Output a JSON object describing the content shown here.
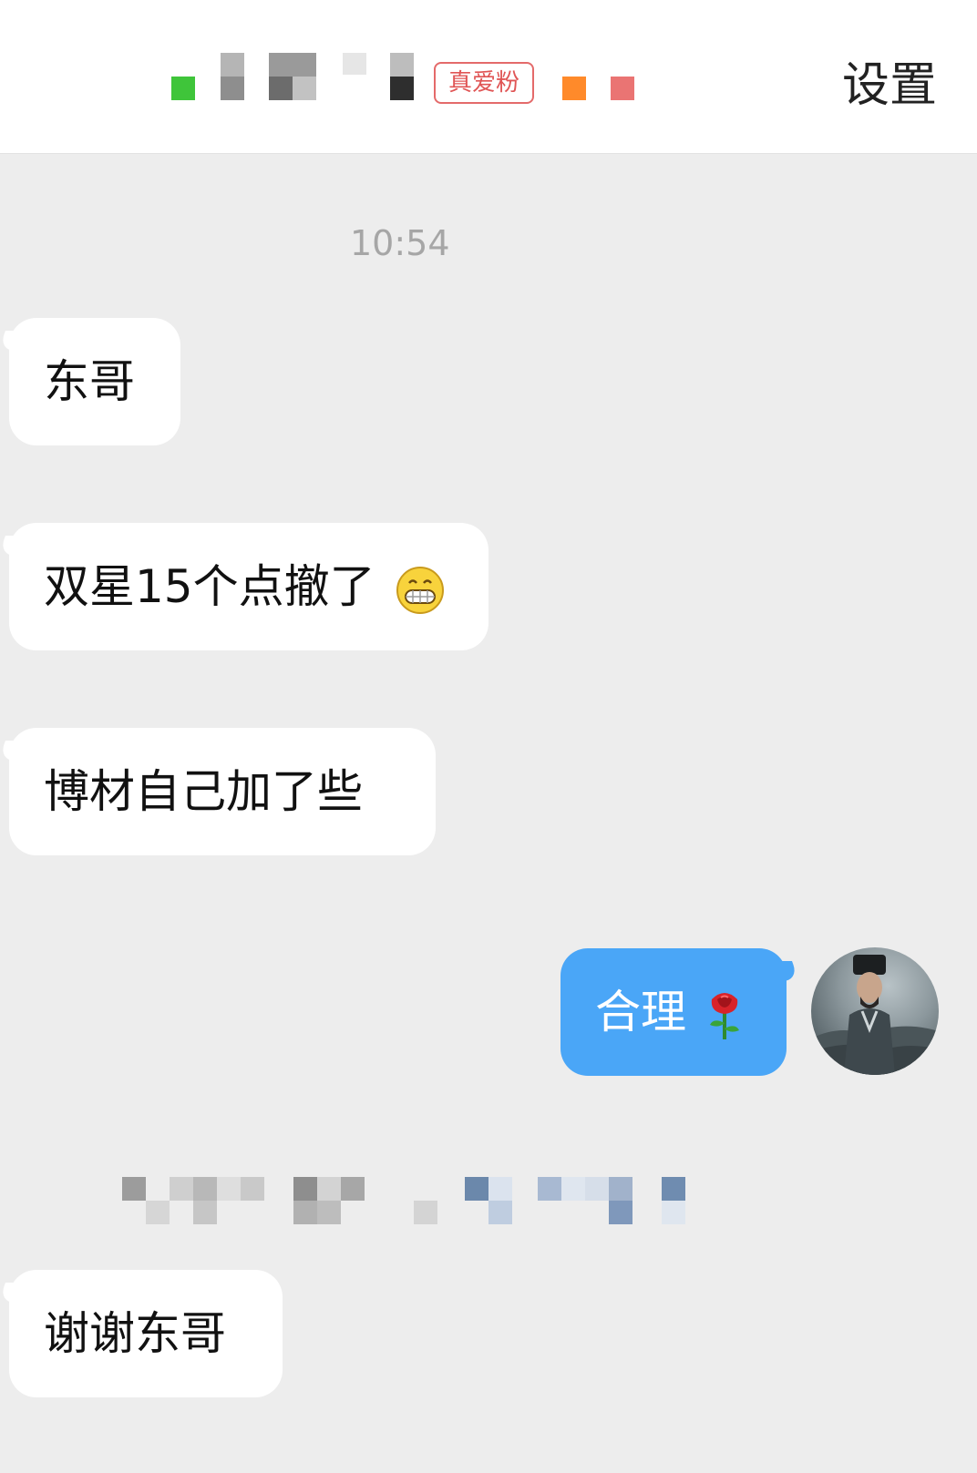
{
  "header": {
    "fan_badge": "真爱粉",
    "settings_label": "设置"
  },
  "chat": {
    "timestamp": "10:54",
    "messages": [
      {
        "direction": "in",
        "text": "东哥"
      },
      {
        "direction": "in",
        "text": "双星15个点撤了",
        "emoji": "grinning-face-icon"
      },
      {
        "direction": "in",
        "text": "博材自己加了些"
      },
      {
        "direction": "out",
        "text": "合理",
        "emoji": "rose-icon"
      },
      {
        "direction": "in",
        "text": "谢谢东哥"
      }
    ]
  },
  "colors": {
    "background": "#ededed",
    "incoming_bubble": "#ffffff",
    "outgoing_bubble": "#4aa6f7",
    "badge_red": "#e05555"
  }
}
